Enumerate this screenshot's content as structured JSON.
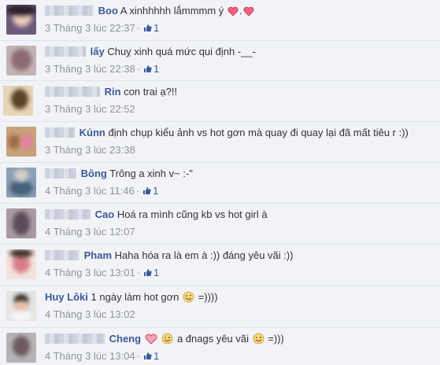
{
  "colors": {
    "author": "#3b5998",
    "text": "#333333",
    "meta": "#90949c",
    "like": "#3b5998",
    "heart": "#f0627f"
  },
  "comments": [
    {
      "author": "Boo",
      "text": "A xinhhhhh lắmmmm ý",
      "emoji_after": [
        "heart-icon",
        "heart-icon"
      ],
      "emoji_sep": ".",
      "time": "3 Tháng 3 lúc 22:37",
      "likes": "1"
    },
    {
      "author": "lấy",
      "text": "Chuỵ xinh quá mức qui định -__-",
      "time": "3 Tháng 3 lúc 22:38",
      "likes": "1"
    },
    {
      "author": "Rin",
      "text": "con trai ạ?!!",
      "time": "3 Tháng 3 lúc 22:52"
    },
    {
      "author": "Kúnn",
      "text": "định chụp kiểu ảnh vs hot gơn mà quay đi quay lại đã mất tiêu r :))",
      "time": "3 Tháng 3 lúc 23:38"
    },
    {
      "author": "Bông",
      "text": "Trông a xinh v~ :-\"",
      "time": "4 Tháng 3 lúc 11:46",
      "likes": "1"
    },
    {
      "author": "Cao",
      "text": "Hoá ra mình cũng kb vs hot girl à",
      "time": "4 Tháng 3 lúc 12:07"
    },
    {
      "author": "Pham",
      "text": "Haha hóa ra là em à :)) đáng yêu vãi :))",
      "time": "4 Tháng 3 lúc 13:01",
      "likes": "1"
    },
    {
      "author": "Huy Lôki",
      "text": "1 ngày làm hot gơn",
      "text_after": "=))))",
      "time": "4 Tháng 3 lúc 13:02"
    },
    {
      "author": "Cheng",
      "text_mid": "a đnags yêu vãi",
      "text_after": "=)))",
      "time": "4 Tháng 3 lúc 13:04",
      "likes": "1"
    }
  ]
}
